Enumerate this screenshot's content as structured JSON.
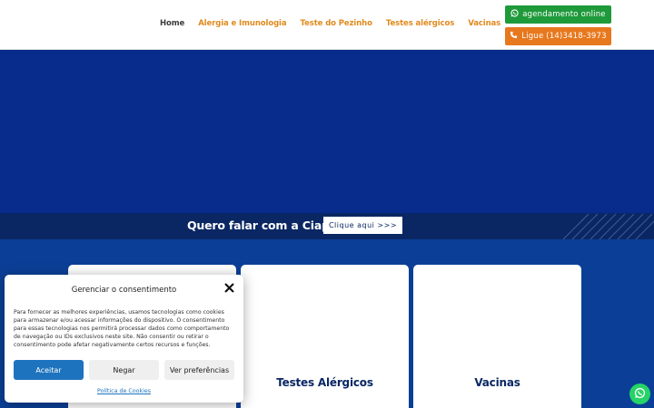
{
  "header": {
    "nav": [
      {
        "label": "Home",
        "active": true
      },
      {
        "label": "Alergia e Imunologia",
        "active": false
      },
      {
        "label": "Teste do Pezinho",
        "active": false
      },
      {
        "label": "Testes alérgicos",
        "active": false
      },
      {
        "label": "Vacinas",
        "active": false
      }
    ],
    "schedule_button": {
      "label": "agendamento online",
      "icon": "whatsapp-icon",
      "color": "#1f9a3b"
    },
    "call_button": {
      "label": "Ligue (14)3418-3973",
      "icon": "phone-icon",
      "color": "#e8781e"
    }
  },
  "cta": {
    "text": "Quero falar com a Ciapi",
    "button_label": "Clique aqui >>>"
  },
  "services": {
    "cards": [
      {
        "title": ""
      },
      {
        "title": "Testes Alérgicos"
      },
      {
        "title": "Vacinas"
      }
    ]
  },
  "cookie_banner": {
    "title": "Gerenciar o consentimento",
    "text": "Para fornecer as melhores experiências, usamos tecnologias como cookies para armazenar e/ou acessar informações do dispositivo. O consentimento para essas tecnologias nos permitirá processar dados como comportamento de navegação ou IDs exclusivos neste site. Não consentir ou retirar o consentimento pode afetar negativamente certos recursos e funções.",
    "accept_label": "Aceitar",
    "deny_label": "Negar",
    "preferences_label": "Ver preferências",
    "policy_link": "Política de Cookies"
  },
  "colors": {
    "hero": "#072c8c",
    "cta_strip": "#0a2763",
    "services_bg": "#0b3f97",
    "nav_link": "#e08a1e",
    "accept": "#1e73be",
    "whatsapp": "#25d366"
  }
}
